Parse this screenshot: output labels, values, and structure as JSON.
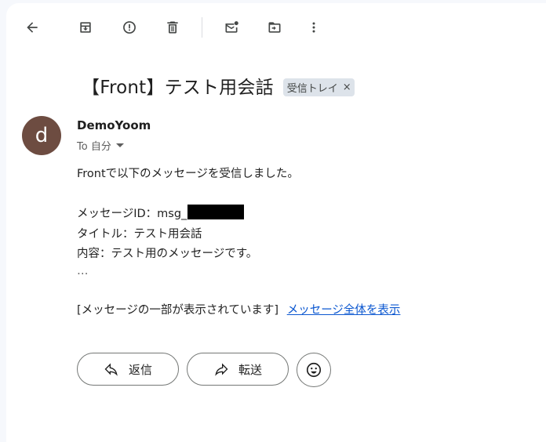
{
  "toolbar": {
    "icons": [
      "back-arrow-icon",
      "archive-icon",
      "report-spam-icon",
      "delete-icon",
      "mark-unread-icon",
      "move-to-icon",
      "more-vert-icon"
    ]
  },
  "email": {
    "subject": "【Front】テスト用会話",
    "label": "受信トレイ",
    "label_close": "×",
    "avatar_letter": "d",
    "sender": "DemoYoom",
    "to": "To 自分",
    "body": {
      "intro": "Frontで以下のメッセージを受信しました。",
      "msg_id_prefix": "メッセージID：msg_",
      "title_line": "タイトル：テスト用会話",
      "content_line": "内容：テスト用のメッセージです。",
      "ellipsis": "…",
      "clipped_note": "[メッセージの一部が表示されています]",
      "view_full_link": "メッセージ全体を表示"
    }
  },
  "actions": {
    "reply": "返信",
    "forward": "転送"
  }
}
